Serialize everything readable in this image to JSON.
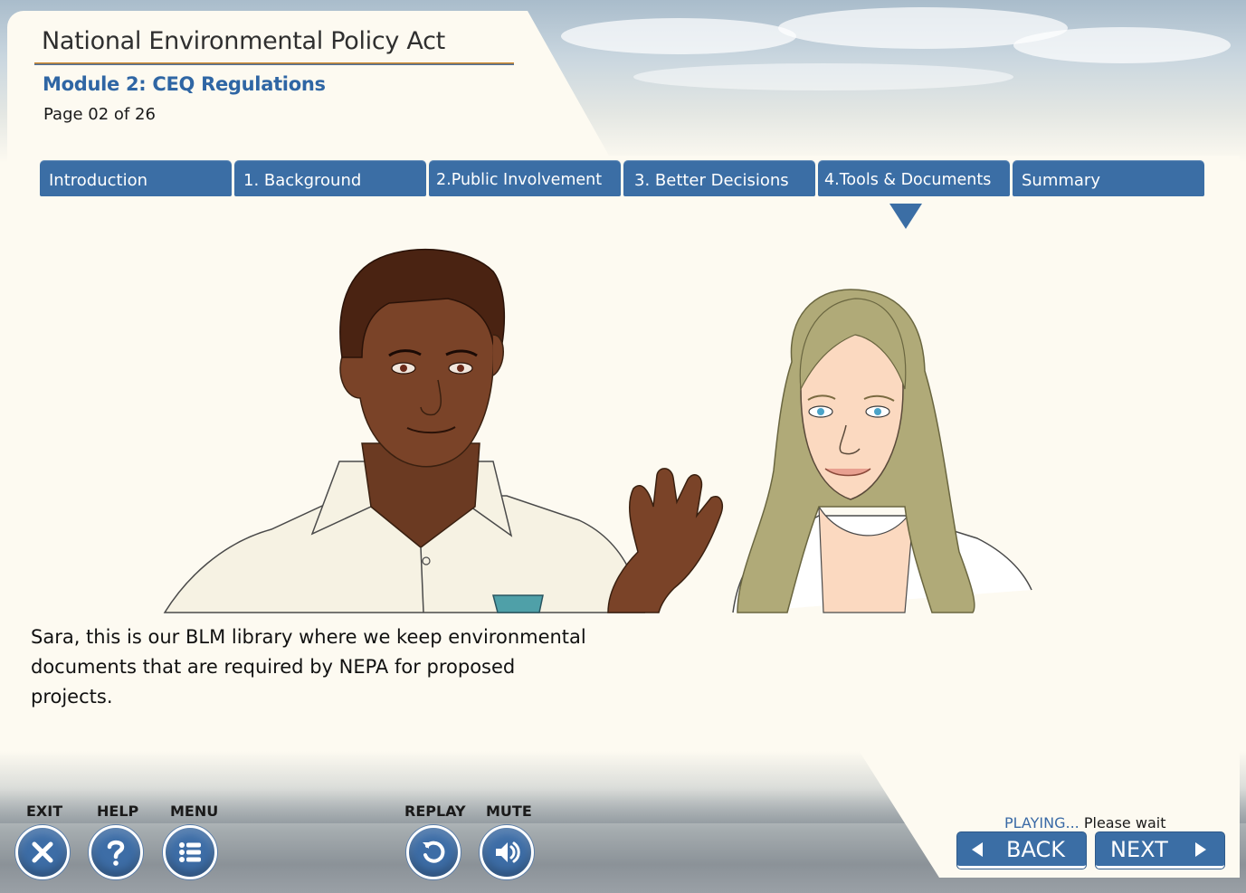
{
  "header": {
    "course_title": "National Environmental Policy Act",
    "module_title": "Module 2: CEQ Regulations",
    "page_indicator": "Page 02 of 26"
  },
  "tabs": [
    {
      "label": "Introduction"
    },
    {
      "label": "1. Background"
    },
    {
      "label": "2.Public Involvement"
    },
    {
      "label": "3. Better Decisions"
    },
    {
      "label": "4.Tools & Documents",
      "active": true
    },
    {
      "label": "Summary"
    }
  ],
  "dialogue": {
    "text": "Sara, this is our BLM library where we keep environmental documents that are required by NEPA for proposed projects."
  },
  "controls": {
    "exit_label": "EXIT",
    "help_label": "HELP",
    "menu_label": "MENU",
    "replay_label": "REPLAY",
    "mute_label": "MUTE"
  },
  "status": {
    "playing": "PLAYING...",
    "wait": "Please wait"
  },
  "navigation": {
    "back_label": "BACK",
    "next_label": "NEXT"
  },
  "colors": {
    "accent": "#3b6ea5",
    "module_title": "#2f66a4",
    "background": "#fdfaf1"
  }
}
